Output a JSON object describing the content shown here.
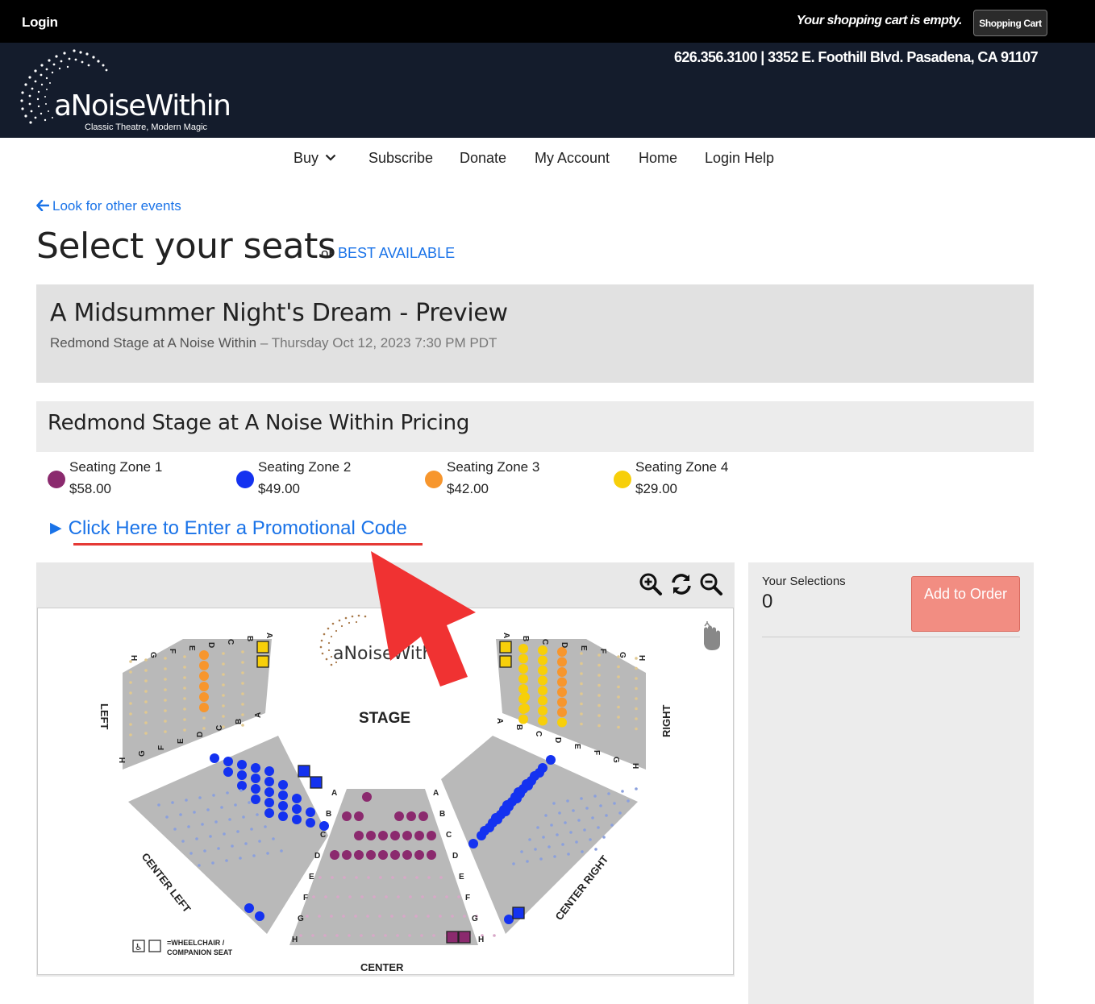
{
  "topbar": {
    "login": "Login",
    "cart_message": "Your shopping cart is empty.",
    "cart_button": "Shopping Cart"
  },
  "header": {
    "contact": "626.356.3100  |  3352 E. Foothill Blvd. Pasadena, CA 91107",
    "logo_word": "aNoiseWithin",
    "logo_tagline": "Classic Theatre, Modern Magic"
  },
  "nav": {
    "items": [
      "Buy",
      "Subscribe",
      "Donate",
      "My Account",
      "Home",
      "Login Help"
    ]
  },
  "back_link": "Look for other events",
  "page_title": "Select your seats",
  "or_text": "or",
  "best_available": "BEST AVAILABLE",
  "event": {
    "title": "A Midsummer Night's Dream - Preview",
    "venue": "Redmond Stage at A Noise Within",
    "datetime": " – Thursday Oct 12, 2023 7:30 PM PDT"
  },
  "pricing": {
    "title": "Redmond Stage at A Noise Within Pricing",
    "zones": [
      {
        "name": "Seating Zone 1",
        "price": "$58.00",
        "color": "#8b2a6e"
      },
      {
        "name": "Seating Zone 2",
        "price": "$49.00",
        "color": "#1432f0"
      },
      {
        "name": "Seating Zone 3",
        "price": "$42.00",
        "color": "#f7962d"
      },
      {
        "name": "Seating Zone 4",
        "price": "$29.00",
        "color": "#f7cf0a"
      }
    ]
  },
  "promo_link": "Click Here to Enter a Promotional Code",
  "map": {
    "logo_text": "aNoiseWithin",
    "stage_label": "STAGE",
    "sections": [
      "LEFT",
      "RIGHT",
      "CENTER LEFT",
      "CENTER",
      "CENTER RIGHT"
    ],
    "legend": "=WHEELCHAIR / COMPANION SEAT",
    "rows": [
      "A",
      "B",
      "C",
      "D",
      "E",
      "F",
      "G",
      "H"
    ]
  },
  "selections": {
    "label": "Your Selections",
    "count": "0",
    "add_button": "Add to Order"
  },
  "colors": {
    "link": "#1a73e8",
    "header_bg": "#141c2c",
    "annotation_red": "#e53935"
  }
}
